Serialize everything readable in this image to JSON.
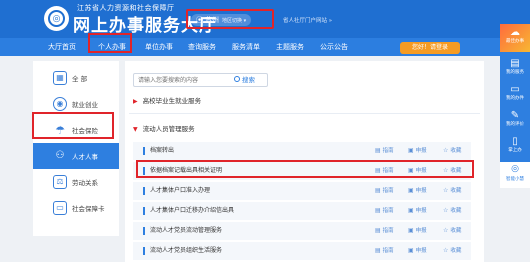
{
  "header": {
    "org_name": "江苏省人力资源和社会保障厅",
    "site_title": "网上办事服务大厅",
    "region": "苏州",
    "region_switch": "地区切换 ▾",
    "province_link": "省人社厅门户网站 »"
  },
  "nav": {
    "items": [
      "大厅首页",
      "个人办事",
      "单位办事",
      "查询服务",
      "服务清单",
      "主题服务",
      "公示公告"
    ],
    "login_label": "您好！请登录"
  },
  "categories": [
    {
      "icon": "grid-icon",
      "label": "全 部"
    },
    {
      "icon": "employment-icon",
      "label": "就业创业"
    },
    {
      "icon": "umbrella-icon",
      "label": "社会保险"
    },
    {
      "icon": "talent-icon",
      "label": "人才人事"
    },
    {
      "icon": "labor-icon",
      "label": "劳动关系"
    },
    {
      "icon": "card-icon",
      "label": "社会保障卡"
    }
  ],
  "search": {
    "placeholder": "请输入您要搜索的内容",
    "button_label": "搜索"
  },
  "sections": [
    {
      "title": "高校毕业生就业服务",
      "expanded": false
    },
    {
      "title": "流动人员管理服务",
      "expanded": true
    }
  ],
  "services": [
    {
      "name": "档案转出"
    },
    {
      "name": "依据档案记载出具相关证明"
    },
    {
      "name": "人才集体户口准入办理"
    },
    {
      "name": "人才集体户口迁移办介绍信出具"
    },
    {
      "name": "流动人才党员流动管理服务"
    },
    {
      "name": "流动人才党员组织生活服务"
    }
  ],
  "actions": {
    "guide": "指南",
    "apply": "申报",
    "favorite": "收藏"
  },
  "sidebar": {
    "items": [
      "最佳办事",
      "我的服务",
      "我的办件",
      "我的评价",
      "掌上办"
    ],
    "help_label": "智能小慧"
  },
  "colors": {
    "primary": "#1f6fd1",
    "nav": "#2c7ee0",
    "highlight": "#e0242a",
    "login": "#f59b23"
  }
}
